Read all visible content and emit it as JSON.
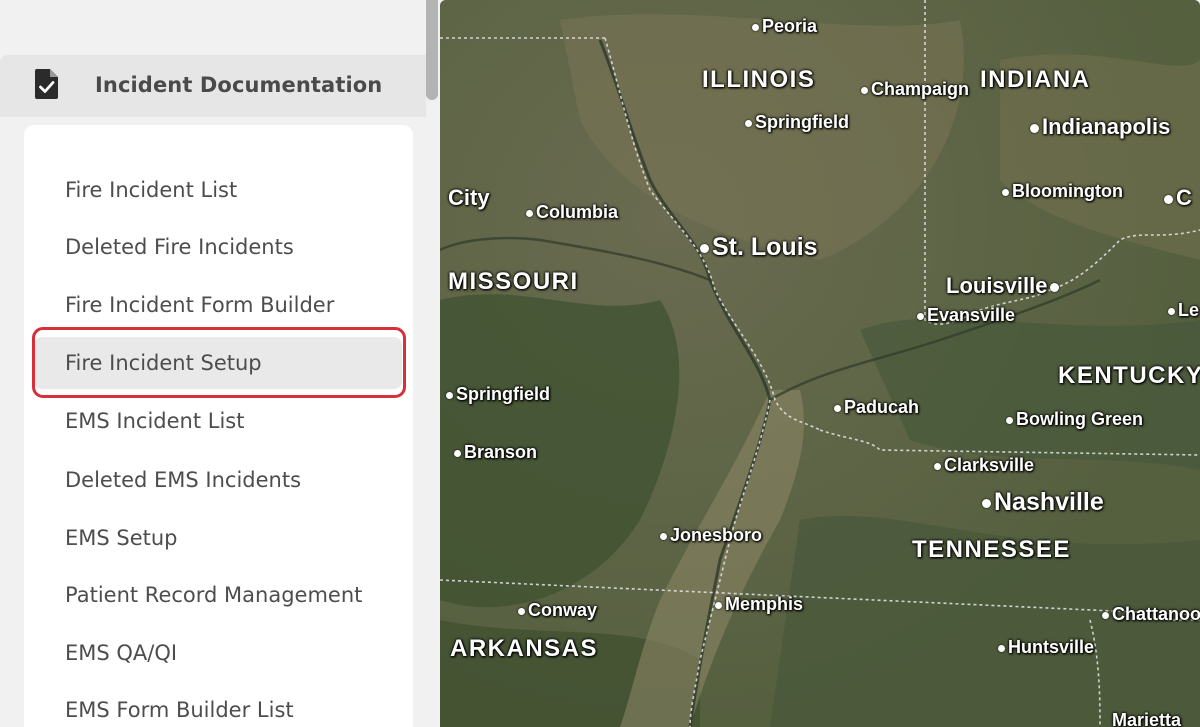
{
  "sidebar": {
    "section_title": "Incident Documentation",
    "section_icon": "document-check-icon",
    "items": [
      {
        "label": "Fire Incident List"
      },
      {
        "label": "Deleted Fire Incidents"
      },
      {
        "label": "Fire Incident Form Builder"
      },
      {
        "label": "Fire Incident Setup",
        "selected": true
      },
      {
        "label": "EMS Incident List"
      },
      {
        "label": "Deleted EMS Incidents"
      },
      {
        "label": "EMS Setup"
      },
      {
        "label": "Patient Record Management"
      },
      {
        "label": "EMS QA/QI"
      },
      {
        "label": "EMS Form Builder List"
      }
    ],
    "highlight_color": "#d7303a"
  },
  "map": {
    "states": [
      "ILLINOIS",
      "INDIANA",
      "MISSOURI",
      "KENTUCKY",
      "TENNESSEE",
      "ARKANSAS"
    ],
    "cities": [
      "Peoria",
      "Champaign",
      "Springfield",
      "Indianapolis",
      "City",
      "Columbia",
      "Bloomington",
      "C",
      "St. Louis",
      "Louisville",
      "Evansville",
      "Le",
      "Springfield",
      "Paducah",
      "Bowling Green",
      "Branson",
      "Clarksville",
      "Nashville",
      "Jonesboro",
      "Conway",
      "Memphis",
      "Chattanoo",
      "Huntsville",
      "Marietta"
    ]
  }
}
